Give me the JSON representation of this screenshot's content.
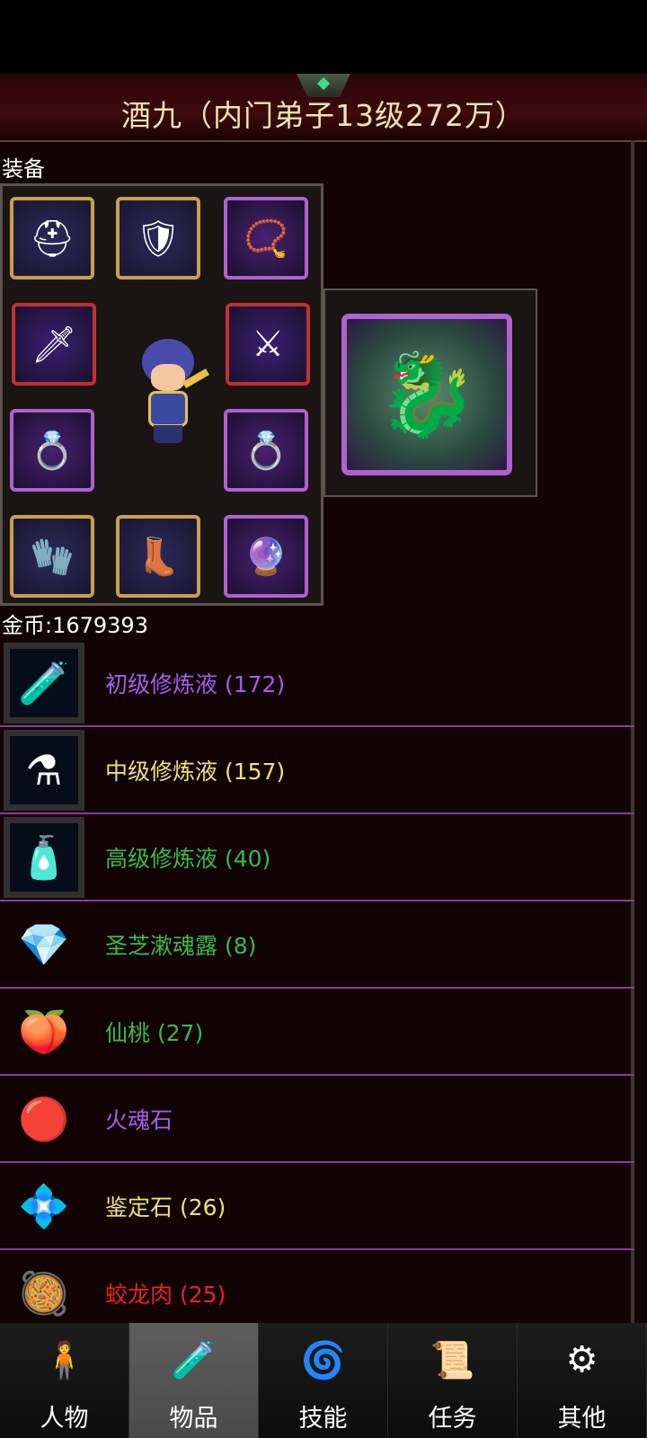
{
  "header": {
    "title": "酒九（内门弟子13级272万）"
  },
  "equipment": {
    "label": "装备",
    "slots": [
      {
        "id": "helmet",
        "icon": "helmet-icon",
        "glyph": "⛑",
        "frame": "gold"
      },
      {
        "id": "armor",
        "icon": "winged-armor-icon",
        "glyph": "🛡",
        "frame": "gold"
      },
      {
        "id": "amulet",
        "icon": "amulet-icon",
        "glyph": "📿",
        "frame": "purple"
      },
      {
        "id": "sword-left",
        "icon": "sword-icon",
        "glyph": "🗡",
        "frame": "red"
      },
      {
        "id": "sword-right",
        "icon": "golden-sword-icon",
        "glyph": "⚔",
        "frame": "red"
      },
      {
        "id": "ring-left",
        "icon": "ring-icon",
        "glyph": "💍",
        "frame": "purple"
      },
      {
        "id": "ring-right",
        "icon": "ring-icon",
        "glyph": "💍",
        "frame": "purple"
      },
      {
        "id": "gloves",
        "icon": "gauntlet-icon",
        "glyph": "🧤",
        "frame": "gold"
      },
      {
        "id": "boots",
        "icon": "boots-icon",
        "glyph": "👢",
        "frame": "gold"
      },
      {
        "id": "orb",
        "icon": "soul-orb-icon",
        "glyph": "🔮",
        "frame": "purple"
      }
    ],
    "pet_icon": "armored-warrior-icon"
  },
  "gold": {
    "label": "金币:1679393"
  },
  "items": [
    {
      "name": "初级修炼液 (172)",
      "color": "#a25ee8",
      "icon": "vial-icon",
      "glyph": "🧪",
      "framed": true
    },
    {
      "name": "中级修炼液 (157)",
      "color": "#efe07a",
      "icon": "flask-icon",
      "glyph": "⚗",
      "framed": true
    },
    {
      "name": "高级修炼液 (40)",
      "color": "#3bb84a",
      "icon": "winged-potion-icon",
      "glyph": "🧴",
      "framed": true
    },
    {
      "name": "圣芝漱魂露 (8)",
      "color": "#3bb84a",
      "icon": "crystal-vase-icon",
      "glyph": "💎",
      "framed": false
    },
    {
      "name": "仙桃 (27)",
      "color": "#3bb84a",
      "icon": "peach-icon",
      "glyph": "🍑",
      "framed": false
    },
    {
      "name": "火魂石",
      "color": "#a25ee8",
      "icon": "fire-stone-icon",
      "glyph": "🔴",
      "framed": false
    },
    {
      "name": "鉴定石 (26)",
      "color": "#efe07a",
      "icon": "gem-icon",
      "glyph": "💠",
      "framed": false
    },
    {
      "name": "蛟龙肉 (25)",
      "color": "#e82424",
      "icon": "meat-bowl-icon",
      "glyph": "🥘",
      "framed": false
    }
  ],
  "nav": [
    {
      "label": "人物",
      "icon": "character-icon",
      "glyph": "🧍",
      "active": false
    },
    {
      "label": "物品",
      "icon": "potion-bag-icon",
      "glyph": "🧪",
      "active": true
    },
    {
      "label": "技能",
      "icon": "skill-swirl-icon",
      "glyph": "🌀",
      "active": false
    },
    {
      "label": "任务",
      "icon": "quest-icon",
      "glyph": "📜",
      "active": false
    },
    {
      "label": "其他",
      "icon": "other-icon",
      "glyph": "⚙",
      "active": false
    }
  ]
}
